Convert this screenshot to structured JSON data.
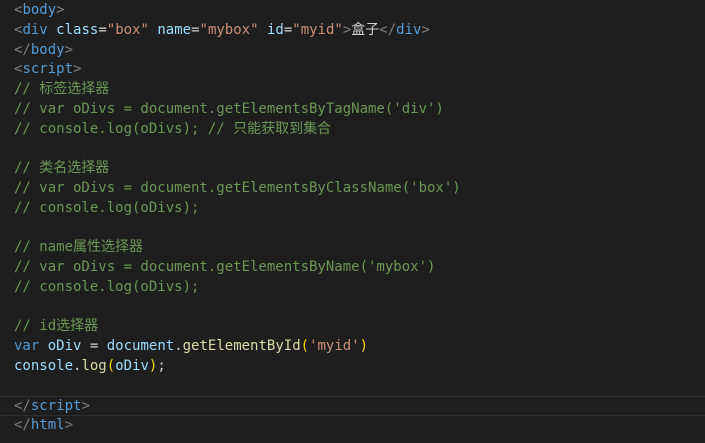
{
  "editor": {
    "lines": {
      "l1": {
        "open": "<",
        "tag": "body",
        "close": ">"
      },
      "l2": {
        "open": "<",
        "tag": "div",
        "attr1": "class",
        "eq1": "=",
        "val1": "\"box\"",
        "attr2": "name",
        "eq2": "=",
        "val2": "\"mybox\"",
        "attr3": "id",
        "eq3": "=",
        "val3": "\"myid\"",
        "close": ">",
        "content": "盒子",
        "end_open": "</",
        "end_tag": "div",
        "end_close": ">"
      },
      "l3": {
        "open": "</",
        "tag": "body",
        "close": ">"
      },
      "l4": {
        "open": "<",
        "tag": "script",
        "close": ">"
      },
      "l5": "// 标签选择器",
      "l6": "// var oDivs = document.getElementsByTagName('div')",
      "l7": "// console.log(oDivs); // 只能获取到集合",
      "l8": "",
      "l9": "// 类名选择器",
      "l10": "// var oDivs = document.getElementsByClassName('box')",
      "l11": "// console.log(oDivs);",
      "l12": "",
      "l13": "// name属性选择器",
      "l14": "// var oDivs = document.getElementsByName('mybox')",
      "l15": "// console.log(oDivs);",
      "l16": "",
      "l17": "// id选择器",
      "l18": {
        "kw": "var",
        "name": "oDiv",
        "eq": " = ",
        "obj": "document",
        "dot": ".",
        "method": "getElementById",
        "lp": "(",
        "arg": "'myid'",
        "rp": ")"
      },
      "l19": {
        "obj": "console",
        "dot": ".",
        "method": "log",
        "lp": "(",
        "arg": "oDiv",
        "rp": ")",
        "semi": ";"
      },
      "l20": "",
      "l21": {
        "open": "</",
        "tag": "script",
        "close": ">"
      },
      "l22": {
        "open": "</",
        "tag": "html",
        "close": ">"
      }
    }
  }
}
